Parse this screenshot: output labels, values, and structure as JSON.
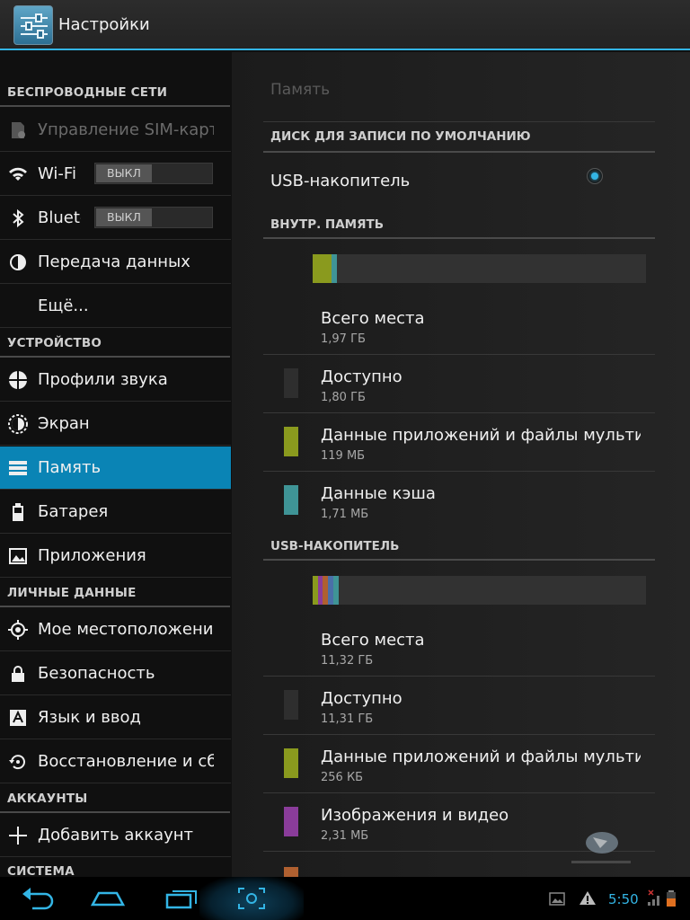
{
  "actionbar": {
    "title": "Настройки"
  },
  "sidebar": {
    "sections": [
      {
        "header": "БЕСПРОВОДНЫЕ СЕТИ"
      },
      {
        "header": "УСТРОЙСТВО"
      },
      {
        "header": "ЛИЧНЫЕ ДАННЫЕ"
      },
      {
        "header": "АККАУНТЫ"
      },
      {
        "header": "СИСТЕМА"
      }
    ],
    "items": [
      {
        "label": "Управление SIM-картами",
        "icon": "sim-card-icon",
        "disabled": true
      },
      {
        "label": "Wi-Fi",
        "icon": "wifi-icon",
        "toggle": "ВЫКЛ"
      },
      {
        "label": "Bluetooth",
        "icon": "bluetooth-icon",
        "toggle": "ВЫКЛ"
      },
      {
        "label": "Передача данных",
        "icon": "data-usage-icon"
      },
      {
        "label": "Ещё..."
      },
      {
        "label": "Профили звука",
        "icon": "sound-icon"
      },
      {
        "label": "Экран",
        "icon": "display-icon"
      },
      {
        "label": "Память",
        "icon": "storage-icon",
        "selected": true
      },
      {
        "label": "Батарея",
        "icon": "battery-icon"
      },
      {
        "label": "Приложения",
        "icon": "apps-icon"
      },
      {
        "label": "Мое местоположение",
        "icon": "location-icon"
      },
      {
        "label": "Безопасность",
        "icon": "lock-icon"
      },
      {
        "label": "Язык и ввод",
        "icon": "language-icon"
      },
      {
        "label": "Восстановление и сброс",
        "icon": "backup-icon"
      },
      {
        "label": "Добавить аккаунт",
        "icon": "plus-icon"
      }
    ]
  },
  "storage": {
    "title": "Память",
    "default_disk_header": "ДИСК ДЛЯ ЗАПИСИ ПО УМОЛЧАНИЮ",
    "default_disk_option": "USB-накопитель",
    "internal": {
      "header": "ВНУТР. ПАМЯТЬ",
      "rows": [
        {
          "title": "Всего места",
          "value": "1,97 ГБ",
          "color": ""
        },
        {
          "title": "Доступно",
          "value": "1,80 ГБ",
          "color": "#2e2e2e"
        },
        {
          "title": "Данные приложений и файлы мультимедиа",
          "value": "119 МБ",
          "color": "#8a9a1e"
        },
        {
          "title": "Данные кэша",
          "value": "1,71 МБ",
          "color": "#3f9496"
        }
      ],
      "usage_fractions": {
        "apps": 0.057,
        "cache": 0.016
      }
    },
    "usb": {
      "header": "USB-НАКОПИТЕЛЬ",
      "rows": [
        {
          "title": "Всего места",
          "value": "11,32 ГБ",
          "color": ""
        },
        {
          "title": "Доступно",
          "value": "11,31 ГБ",
          "color": "#2e2e2e"
        },
        {
          "title": "Данные приложений и файлы мультимедиа",
          "value": "256 КБ",
          "color": "#8a9a1e"
        },
        {
          "title": "Изображения и видео",
          "value": "2,31 МБ",
          "color": "#8a3c9a"
        }
      ]
    }
  },
  "status": {
    "time": "5:50"
  },
  "colors": {
    "accent": "#33b5e5",
    "selected": "#0a84b5"
  }
}
